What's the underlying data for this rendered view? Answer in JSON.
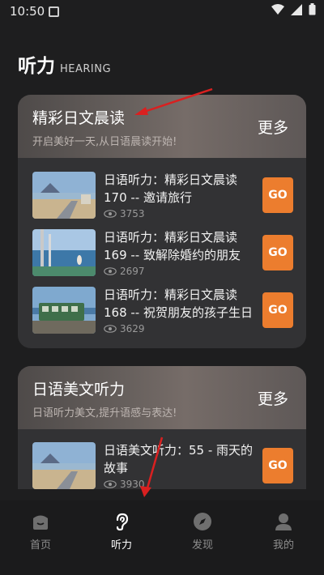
{
  "status": {
    "time": "10:50"
  },
  "header": {
    "title": "听力",
    "subtitle": "HEARING"
  },
  "sections": [
    {
      "title": "精彩日文晨读",
      "desc": "开启美好一天,从日语晨读开始!",
      "more": "更多",
      "items": [
        {
          "title": "日语听力：精彩日文晨读170 -- 邀请旅行",
          "views": "3753",
          "go": "GO"
        },
        {
          "title": "日语听力：精彩日文晨读169 -- 致解除婚约的朋友",
          "views": "2697",
          "go": "GO"
        },
        {
          "title": "日语听力：精彩日文晨读168 -- 祝贺朋友的孩子生日",
          "views": "3629",
          "go": "GO"
        }
      ]
    },
    {
      "title": "日语美文听力",
      "desc": "日语听力美文,提升语感与表达!",
      "more": "更多",
      "items": [
        {
          "title": "日语美文听力：55 - 雨天的故事",
          "views": "3930",
          "go": "GO"
        }
      ]
    }
  ],
  "nav": [
    {
      "label": "首页",
      "icon": "home-icon",
      "active": false
    },
    {
      "label": "听力",
      "icon": "ear-icon",
      "active": true
    },
    {
      "label": "发现",
      "icon": "compass-icon",
      "active": false
    },
    {
      "label": "我的",
      "icon": "person-icon",
      "active": false
    }
  ],
  "colors": {
    "accent": "#ec7d2e",
    "background": "#1e1e1f",
    "card": "#323234",
    "annotation": "#d92020"
  }
}
